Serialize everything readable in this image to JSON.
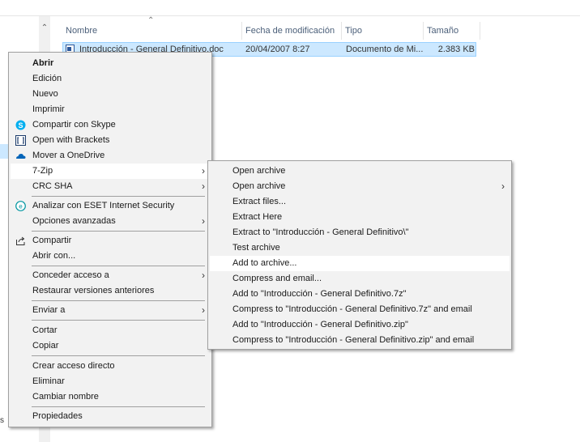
{
  "file_list": {
    "columns": [
      "Nombre",
      "Fecha de modificación",
      "Tipo",
      "Tamaño"
    ],
    "rows": [
      {
        "name": "Introducción - General Definitivo.doc",
        "modified": "20/04/2007 8:27",
        "type": "Documento de Mi...",
        "size": "2.383 KB"
      }
    ]
  },
  "left_fragment": "s",
  "context_menu": {
    "items": [
      {
        "label": "Abrir"
      },
      {
        "label": "Edición"
      },
      {
        "label": "Nuevo"
      },
      {
        "label": "Imprimir"
      },
      {
        "label": "Compartir con Skype",
        "icon": "skype-icon"
      },
      {
        "label": "Open with Brackets",
        "icon": "brackets-icon"
      },
      {
        "label": "Mover a OneDrive",
        "icon": "onedrive-icon"
      },
      {
        "label": "7-Zip",
        "submenu": true
      },
      {
        "label": "CRC SHA",
        "submenu": true
      },
      {
        "label": "Analizar con ESET Internet Security",
        "icon": "eset-icon"
      },
      {
        "label": "Opciones avanzadas",
        "submenu": true
      },
      {
        "label": "Compartir",
        "icon": "share-icon"
      },
      {
        "label": "Abrir con..."
      },
      {
        "label": "Conceder acceso a",
        "submenu": true
      },
      {
        "label": "Restaurar versiones anteriores"
      },
      {
        "label": "Enviar a",
        "submenu": true
      },
      {
        "label": "Cortar"
      },
      {
        "label": "Copiar"
      },
      {
        "label": "Crear acceso directo"
      },
      {
        "label": "Eliminar"
      },
      {
        "label": "Cambiar nombre"
      },
      {
        "label": "Propiedades"
      }
    ]
  },
  "submenu_7zip": {
    "items": [
      {
        "label": "Open archive"
      },
      {
        "label": "Open archive",
        "submenu": true
      },
      {
        "label": "Extract files..."
      },
      {
        "label": "Extract Here"
      },
      {
        "label": "Extract to \"Introducción - General Definitivo\\\""
      },
      {
        "label": "Test archive"
      },
      {
        "label": "Add to archive..."
      },
      {
        "label": "Compress and email..."
      },
      {
        "label": "Add to \"Introducción - General Definitivo.7z\""
      },
      {
        "label": "Compress to \"Introducción - General Definitivo.7z\" and email"
      },
      {
        "label": "Add to \"Introducción - General Definitivo.zip\""
      },
      {
        "label": "Compress to \"Introducción - General Definitivo.zip\" and email"
      }
    ]
  },
  "colors": {
    "selection": "#cce8ff",
    "menu_bg": "#f2f2f2",
    "header_text": "#4c607a"
  }
}
